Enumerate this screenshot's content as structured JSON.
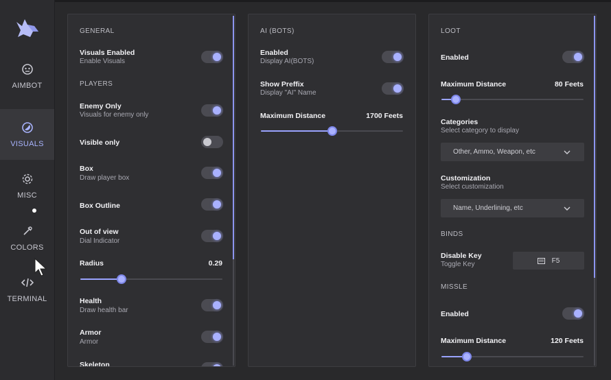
{
  "sidebar": {
    "items": [
      {
        "label": "AIMBOT",
        "icon": "robot-icon"
      },
      {
        "label": "VISUALS",
        "icon": "eye-icon"
      },
      {
        "label": "MISC",
        "icon": "gear-icon"
      },
      {
        "label": "COLORS",
        "icon": "eyedropper-icon"
      },
      {
        "label": "TERMINAL",
        "icon": "code-icon"
      }
    ],
    "active": "VISUALS"
  },
  "colors": {
    "accent": "#a9b1ff",
    "panel": "#2f2f32",
    "background": "#29292b"
  },
  "general": {
    "title": "GENERAL",
    "visuals_enabled": {
      "label": "Visuals Enabled",
      "sub": "Enable Visuals",
      "on": true
    },
    "players_title": "PLAYERS",
    "enemy_only": {
      "label": "Enemy Only",
      "sub": "Visuals for enemy only",
      "on": true
    },
    "visible_only": {
      "label": "Visible only",
      "on": false
    },
    "box": {
      "label": "Box",
      "sub": "Draw player box",
      "on": true
    },
    "box_outline": {
      "label": "Box Outline",
      "on": true
    },
    "out_of_view": {
      "label": "Out of view",
      "sub": "Dial Indicator",
      "on": true
    },
    "radius": {
      "label": "Radius",
      "value": "0.29",
      "fraction": 0.29
    },
    "health": {
      "label": "Health",
      "sub": "Draw health bar",
      "on": true
    },
    "armor": {
      "label": "Armor",
      "sub": "Armor",
      "on": true
    },
    "skeleton": {
      "label": "Skeleton"
    }
  },
  "ai_bots": {
    "title": "AI (BOTS)",
    "enabled": {
      "label": "Enabled",
      "sub": "Display AI(BOTS)",
      "on": true
    },
    "show_prefix": {
      "label": "Show Preffix",
      "sub": "Display \"AI\" Name",
      "on": true
    },
    "max_distance": {
      "label": "Maximum Distance",
      "value": "1700 Feets",
      "fraction": 0.5
    }
  },
  "loot": {
    "title": "LOOT",
    "enabled": {
      "label": "Enabled",
      "on": true
    },
    "max_distance": {
      "label": "Maximum Distance",
      "value": "80 Feets",
      "fraction": 0.1
    },
    "categories": {
      "label": "Categories",
      "sub": "Select category to display",
      "selected": "Other, Ammo, Weapon, etc"
    },
    "customization": {
      "label": "Customization",
      "sub": "Select customization",
      "selected": "Name, Underlining, etc"
    },
    "binds_title": "BINDS",
    "disable_key": {
      "label": "Disable Key",
      "sub": "Toggle Key",
      "key": "F5"
    },
    "missle_title": "MISSLE",
    "missle_enabled": {
      "label": "Enabled",
      "on": true
    },
    "missle_max_distance": {
      "label": "Maximum Distance",
      "value": "120 Feets",
      "fraction": 0.18
    }
  }
}
